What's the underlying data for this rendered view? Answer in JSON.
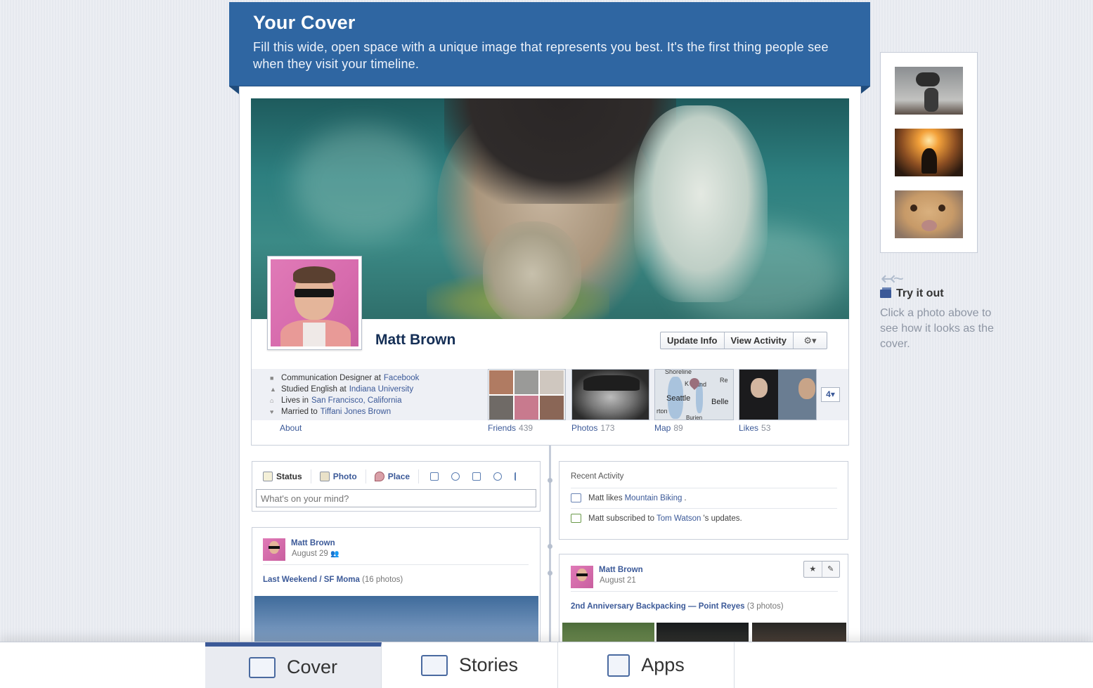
{
  "banner": {
    "title": "Your Cover",
    "description": "Fill this wide, open space with a unique image that represents you best. It's the first thing people see when they visit your timeline."
  },
  "profile": {
    "name": "Matt Brown",
    "buttons": {
      "update_info": "Update Info",
      "view_activity": "View Activity",
      "settings": "⚙▾"
    },
    "info": [
      {
        "icon": "briefcase-icon",
        "text": "Communication Designer at",
        "link": "Facebook"
      },
      {
        "icon": "graduation-icon",
        "text": "Studied English at",
        "link": "Indiana University"
      },
      {
        "icon": "house-icon",
        "text": "Lives in",
        "link": "San Francisco, California"
      },
      {
        "icon": "heart-icon",
        "text": "Married to",
        "link": "Tiffani Jones Brown"
      }
    ],
    "about": "About",
    "tiles": [
      {
        "label": "Friends",
        "count": "439"
      },
      {
        "label": "Photos",
        "count": "173"
      },
      {
        "label": "Map",
        "count": "89"
      },
      {
        "label": "Likes",
        "count": "53"
      }
    ],
    "more_count": "4",
    "map_labels": {
      "top": "Shoreline",
      "city1": "Seattle",
      "city2": "Belle",
      "k": "K",
      "and": "and",
      "re": "Re",
      "rton": "rton",
      "burien": "Burien"
    }
  },
  "composer": {
    "tabs": [
      "Status",
      "Photo",
      "Place"
    ],
    "placeholder": "What's on your mind?"
  },
  "recent": {
    "title": "Recent Activity",
    "items": [
      {
        "pre": "Matt likes",
        "link": "Mountain Biking",
        "post": "."
      },
      {
        "pre": "Matt subscribed to",
        "link": "Tom Watson",
        "post": "'s updates."
      }
    ]
  },
  "posts": [
    {
      "author": "Matt Brown",
      "date": "August 29",
      "album": "Last Weekend",
      "sep": "/",
      "place": "SF Moma",
      "extra": "(16 photos)"
    },
    {
      "author": "Matt Brown",
      "date": "August 21",
      "album": "2nd Anniversary Backpacking",
      "sep": "—",
      "place": "Point Reyes",
      "extra": "(3 photos)"
    }
  ],
  "post_buttons": {
    "star": "★",
    "edit": "✎"
  },
  "side": {
    "try_title": "Try it out",
    "try_desc": "Click a photo above to see how it looks as the cover."
  },
  "bottom_tabs": [
    {
      "label": "Cover",
      "icon": "cover-icon",
      "selected": true
    },
    {
      "label": "Stories",
      "icon": "stories-icon",
      "selected": false
    },
    {
      "label": "Apps",
      "icon": "apps-icon",
      "selected": false
    }
  ],
  "colors": {
    "brand": "#3b5998",
    "banner": "#2f66a2"
  }
}
